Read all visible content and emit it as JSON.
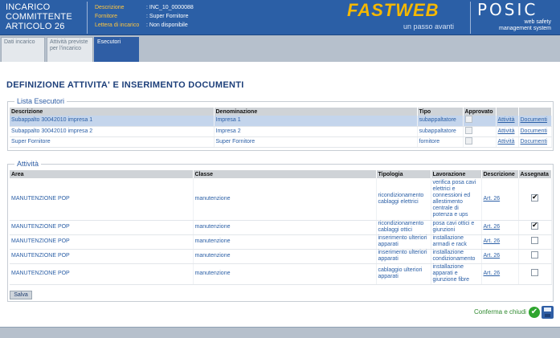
{
  "header": {
    "title_lines": [
      "INCARICO",
      "COMMITTENTE",
      "ARTICOLO 26"
    ],
    "fields": [
      {
        "label": "Descrizione",
        "value": ": INC_10_0000088"
      },
      {
        "label": "Fornitore",
        "value": ": Super Fornitore"
      },
      {
        "label": "Lettera di incarico",
        "value": ": Non disponibile"
      }
    ],
    "brand": "FASTWEB",
    "tagline": "un passo avanti",
    "product": "POSIC",
    "product_sub_1": "web safety",
    "product_sub_2": "management system"
  },
  "tabs": [
    {
      "label": "Dati incarico",
      "active": false
    },
    {
      "label": "Attività previste per l'incarico",
      "active": false
    },
    {
      "label": "Esecutori",
      "active": true
    }
  ],
  "page_title": "DEFINIZIONE ATTIVITA' E INSERIMENTO DOCUMENTI",
  "esecutori": {
    "legend": "Lista Esecutori",
    "columns": [
      "Descrizione",
      "Denominazione",
      "Tipo",
      "Approvato",
      "",
      ""
    ],
    "rows": [
      {
        "descrizione": "Subappalto 30042010 impresa 1",
        "denominazione": "Impresa 1",
        "tipo": "subappaltatore",
        "approvato": false,
        "attivita": "Attività",
        "documenti": "Documenti",
        "selected": true
      },
      {
        "descrizione": "Subappalto 30042010 impresa 2",
        "denominazione": "Impresa 2",
        "tipo": "subappaltatore",
        "approvato": false,
        "attivita": "Attività",
        "documenti": "Documenti",
        "selected": false
      },
      {
        "descrizione": "Super Fornitore",
        "denominazione": "Super Fornitore",
        "tipo": "fornitore",
        "approvato": false,
        "attivita": "Attività",
        "documenti": "Documenti",
        "selected": false
      }
    ]
  },
  "attivita": {
    "legend": "Attività",
    "columns": [
      "Area",
      "Classe",
      "Tipologia",
      "Lavorazione",
      "Descrizione",
      "Assegnata"
    ],
    "rows": [
      {
        "area": "MANUTENZIONE POP",
        "classe": "manutenzione",
        "tipologia": "ricondizionamento cablaggi elettrici",
        "lavorazione": "verifica posa cavi elettrici e connessioni ed allestimento centrale di potenza e ups",
        "descrizione": "Art. 26",
        "assegnata": true
      },
      {
        "area": "MANUTENZIONE POP",
        "classe": "manutenzione",
        "tipologia": "ricondizionamento cablaggi ottici",
        "lavorazione": "posa cavi ottici e giunzioni",
        "descrizione": "Art. 26",
        "assegnata": true
      },
      {
        "area": "MANUTENZIONE POP",
        "classe": "manutenzione",
        "tipologia": "inserimento ulteriori apparati",
        "lavorazione": "installazione armadi e rack",
        "descrizione": "Art. 26",
        "assegnata": false
      },
      {
        "area": "MANUTENZIONE POP",
        "classe": "manutenzione",
        "tipologia": "inserimento ulteriori apparati",
        "lavorazione": "installazione condizionamento",
        "descrizione": "Art. 26",
        "assegnata": false
      },
      {
        "area": "MANUTENZIONE POP",
        "classe": "manutenzione",
        "tipologia": "cablaggio ulteriori apparati",
        "lavorazione": "installazione apparati e giunzione fibre",
        "descrizione": "Art. 26",
        "assegnata": false
      }
    ]
  },
  "buttons": {
    "save": "Salva",
    "confirm": "Conferma e chiudi"
  },
  "colors": {
    "header_bg": "#2b5fa6",
    "accent_yellow": "#f5b800",
    "link": "#2b5fa6",
    "selected_row": "#c4d5ec",
    "confirm_green": "#2fa52f"
  }
}
